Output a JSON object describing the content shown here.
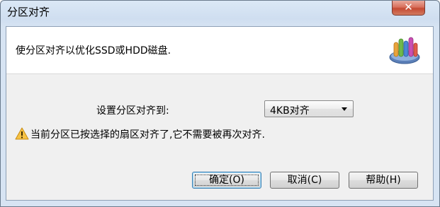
{
  "window": {
    "title": "分区对齐",
    "close_glyph": "✕"
  },
  "header": {
    "description": "使分区对齐以优化SSD或HDD磁盘.",
    "icon": "partition-tool-icon"
  },
  "form": {
    "align_label": "设置分区对齐到:",
    "align_select": {
      "value": "4KB对齐"
    },
    "warning_icon": "warning-triangle-icon",
    "warning_text": "当前分区已按选择的扇区对齐了,它不需要被再次对齐."
  },
  "buttons": {
    "ok": "确定(O)",
    "cancel": "取消(C)",
    "help": "帮助(H)"
  },
  "colors": {
    "titlebar": "#cfdef0",
    "close_button": "#c54a33",
    "dialog_background": "#f0f0f0",
    "header_background": "#ffffff",
    "default_button_border": "#3c7fb1"
  }
}
